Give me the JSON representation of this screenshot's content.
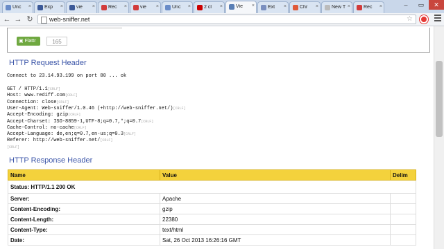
{
  "browser": {
    "tabs": [
      {
        "label": "Unc",
        "favicon_color": "#6a8cc8"
      },
      {
        "label": "Exp",
        "favicon_color": "#3b5998"
      },
      {
        "label": "vie",
        "favicon_color": "#3b5998"
      },
      {
        "label": "Rec",
        "favicon_color": "#d23b3b"
      },
      {
        "label": "vie",
        "favicon_color": "#d23b3b"
      },
      {
        "label": "Unc",
        "favicon_color": "#6a8cc8"
      },
      {
        "label": "2 cl",
        "favicon_color": "#cc0000"
      },
      {
        "label": "Vie",
        "favicon_color": "#5a7fb5"
      },
      {
        "label": "Ext",
        "favicon_color": "#7a8fbf"
      },
      {
        "label": "Chr",
        "favicon_color": "#e05a3a"
      },
      {
        "label": "New T",
        "favicon_color": "#bbbbbb"
      },
      {
        "label": "Rec",
        "favicon_color": "#d23b3b"
      }
    ],
    "url": "web-sniffer.net"
  },
  "flattr": {
    "label": "Flattr",
    "count": "165"
  },
  "request": {
    "heading": "HTTP Request Header",
    "connect": "Connect to 23.14.93.199 on port 80 ... ok",
    "lines": [
      "GET / HTTP/1.1",
      "Host: www.rediff.com",
      "Connection: close",
      "User-Agent: Web-sniffer/1.0.46 (+http://web-sniffer.net/)",
      "Accept-Encoding: gzip",
      "Accept-Charset: ISO-8859-1,UTF-8;q=0.7,*;q=0.7",
      "Cache-Control: no-cache",
      "Accept-Language: de,en;q=0.7,en-us;q=0.3",
      "Referer: http://web-sniffer.net/",
      ""
    ],
    "crlf": "[CRLF]"
  },
  "response": {
    "heading": "HTTP Response Header",
    "columns": [
      "Name",
      "Value",
      "Delim"
    ],
    "status": "Status: HTTP/1.1 200 OK",
    "rows": [
      {
        "name": "Server:",
        "value": "Apache"
      },
      {
        "name": "Content-Encoding:",
        "value": "gzip"
      },
      {
        "name": "Content-Length:",
        "value": "22380"
      },
      {
        "name": "Content-Type:",
        "value": "text/html"
      },
      {
        "name": "Date:",
        "value": "Sat, 26 Oct 2013 16:26:16 GMT"
      }
    ]
  }
}
